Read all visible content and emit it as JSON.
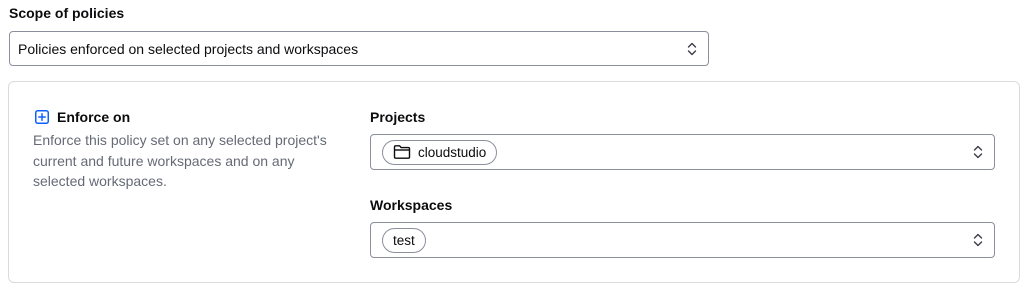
{
  "scope": {
    "label": "Scope of policies",
    "selected": "Policies enforced on selected projects and workspaces"
  },
  "enforce": {
    "title": "Enforce on",
    "description": "Enforce this policy set on any selected project's current and future workspaces and on any selected workspaces.",
    "icon": "plus-square-icon"
  },
  "projects": {
    "label": "Projects",
    "chips": [
      {
        "label": "cloudstudio",
        "icon": "folder-icon"
      }
    ]
  },
  "workspaces": {
    "label": "Workspaces",
    "chips": [
      {
        "label": "test"
      }
    ]
  },
  "colors": {
    "accent": "#1060ff",
    "border": "#8c909c",
    "panel_border": "#dbdbdc",
    "muted_text": "#656a76"
  }
}
